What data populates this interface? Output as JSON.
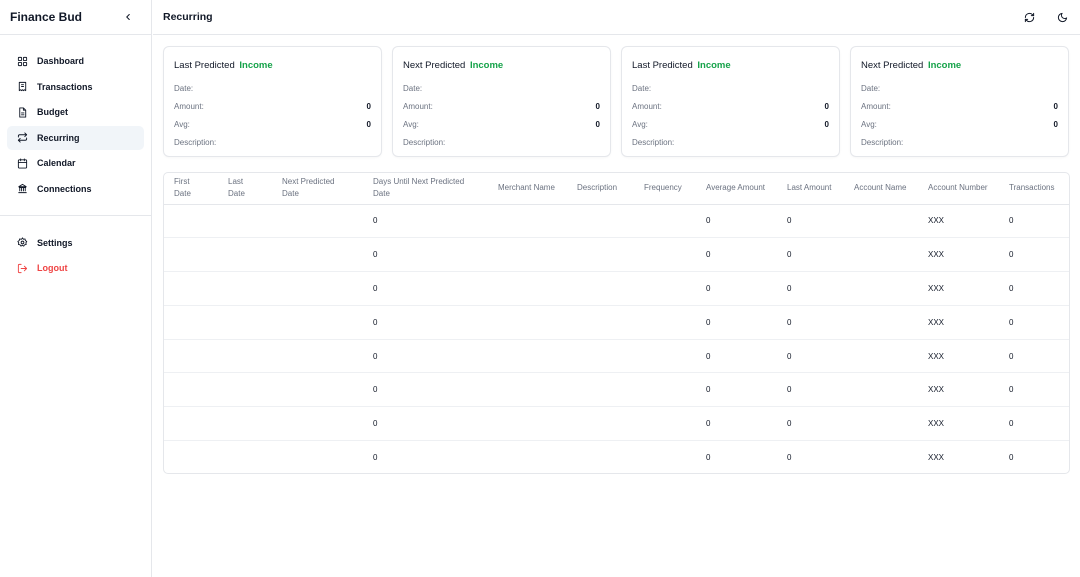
{
  "app": {
    "title": "Finance Bud"
  },
  "sidebar": {
    "items": [
      {
        "label": "Dashboard",
        "icon": "dashboard-icon"
      },
      {
        "label": "Transactions",
        "icon": "receipt-icon"
      },
      {
        "label": "Budget",
        "icon": "document-icon"
      },
      {
        "label": "Recurring",
        "icon": "repeat-icon",
        "active": true
      },
      {
        "label": "Calendar",
        "icon": "calendar-icon"
      },
      {
        "label": "Connections",
        "icon": "bank-icon"
      }
    ],
    "bottom_items": [
      {
        "label": "Settings",
        "icon": "gear-icon"
      },
      {
        "label": "Logout",
        "icon": "logout-icon"
      }
    ]
  },
  "header": {
    "title": "Recurring"
  },
  "cards": [
    {
      "title": "Last Predicted",
      "highlight": "Income",
      "date_label": "Date:",
      "amount_label": "Amount:",
      "amount": "0",
      "avg_label": "Avg:",
      "avg": "0",
      "description_label": "Description:"
    },
    {
      "title": "Next Predicted",
      "highlight": "Income",
      "date_label": "Date:",
      "amount_label": "Amount:",
      "amount": "0",
      "avg_label": "Avg:",
      "avg": "0",
      "description_label": "Description:"
    },
    {
      "title": "Last Predicted",
      "highlight": "Income",
      "date_label": "Date:",
      "amount_label": "Amount:",
      "amount": "0",
      "avg_label": "Avg:",
      "avg": "0",
      "description_label": "Description:"
    },
    {
      "title": "Next Predicted",
      "highlight": "Income",
      "date_label": "Date:",
      "amount_label": "Amount:",
      "amount": "0",
      "avg_label": "Avg:",
      "avg": "0",
      "description_label": "Description:"
    }
  ],
  "table": {
    "columns": [
      "First Date",
      "Last Date",
      "Next Predicted Date",
      "Days Until Next Predicted Date",
      "Merchant Name",
      "Description",
      "Frequency",
      "Average Amount",
      "Last Amount",
      "Account Name",
      "Account Number",
      "Transactions"
    ],
    "rows": [
      [
        "",
        "",
        "",
        "0",
        "",
        "",
        "",
        "0",
        "0",
        "",
        "XXX",
        "0"
      ],
      [
        "",
        "",
        "",
        "0",
        "",
        "",
        "",
        "0",
        "0",
        "",
        "XXX",
        "0"
      ],
      [
        "",
        "",
        "",
        "0",
        "",
        "",
        "",
        "0",
        "0",
        "",
        "XXX",
        "0"
      ],
      [
        "",
        "",
        "",
        "0",
        "",
        "",
        "",
        "0",
        "0",
        "",
        "XXX",
        "0"
      ],
      [
        "",
        "",
        "",
        "0",
        "",
        "",
        "",
        "0",
        "0",
        "",
        "XXX",
        "0"
      ],
      [
        "",
        "",
        "",
        "0",
        "",
        "",
        "",
        "0",
        "0",
        "",
        "XXX",
        "0"
      ],
      [
        "",
        "",
        "",
        "0",
        "",
        "",
        "",
        "0",
        "0",
        "",
        "XXX",
        "0"
      ],
      [
        "",
        "",
        "",
        "0",
        "",
        "",
        "",
        "0",
        "0",
        "",
        "XXX",
        "0"
      ]
    ]
  },
  "colors": {
    "income": "#16a34a",
    "logout": "#ef4444",
    "active_bg": "#f1f5f9"
  }
}
